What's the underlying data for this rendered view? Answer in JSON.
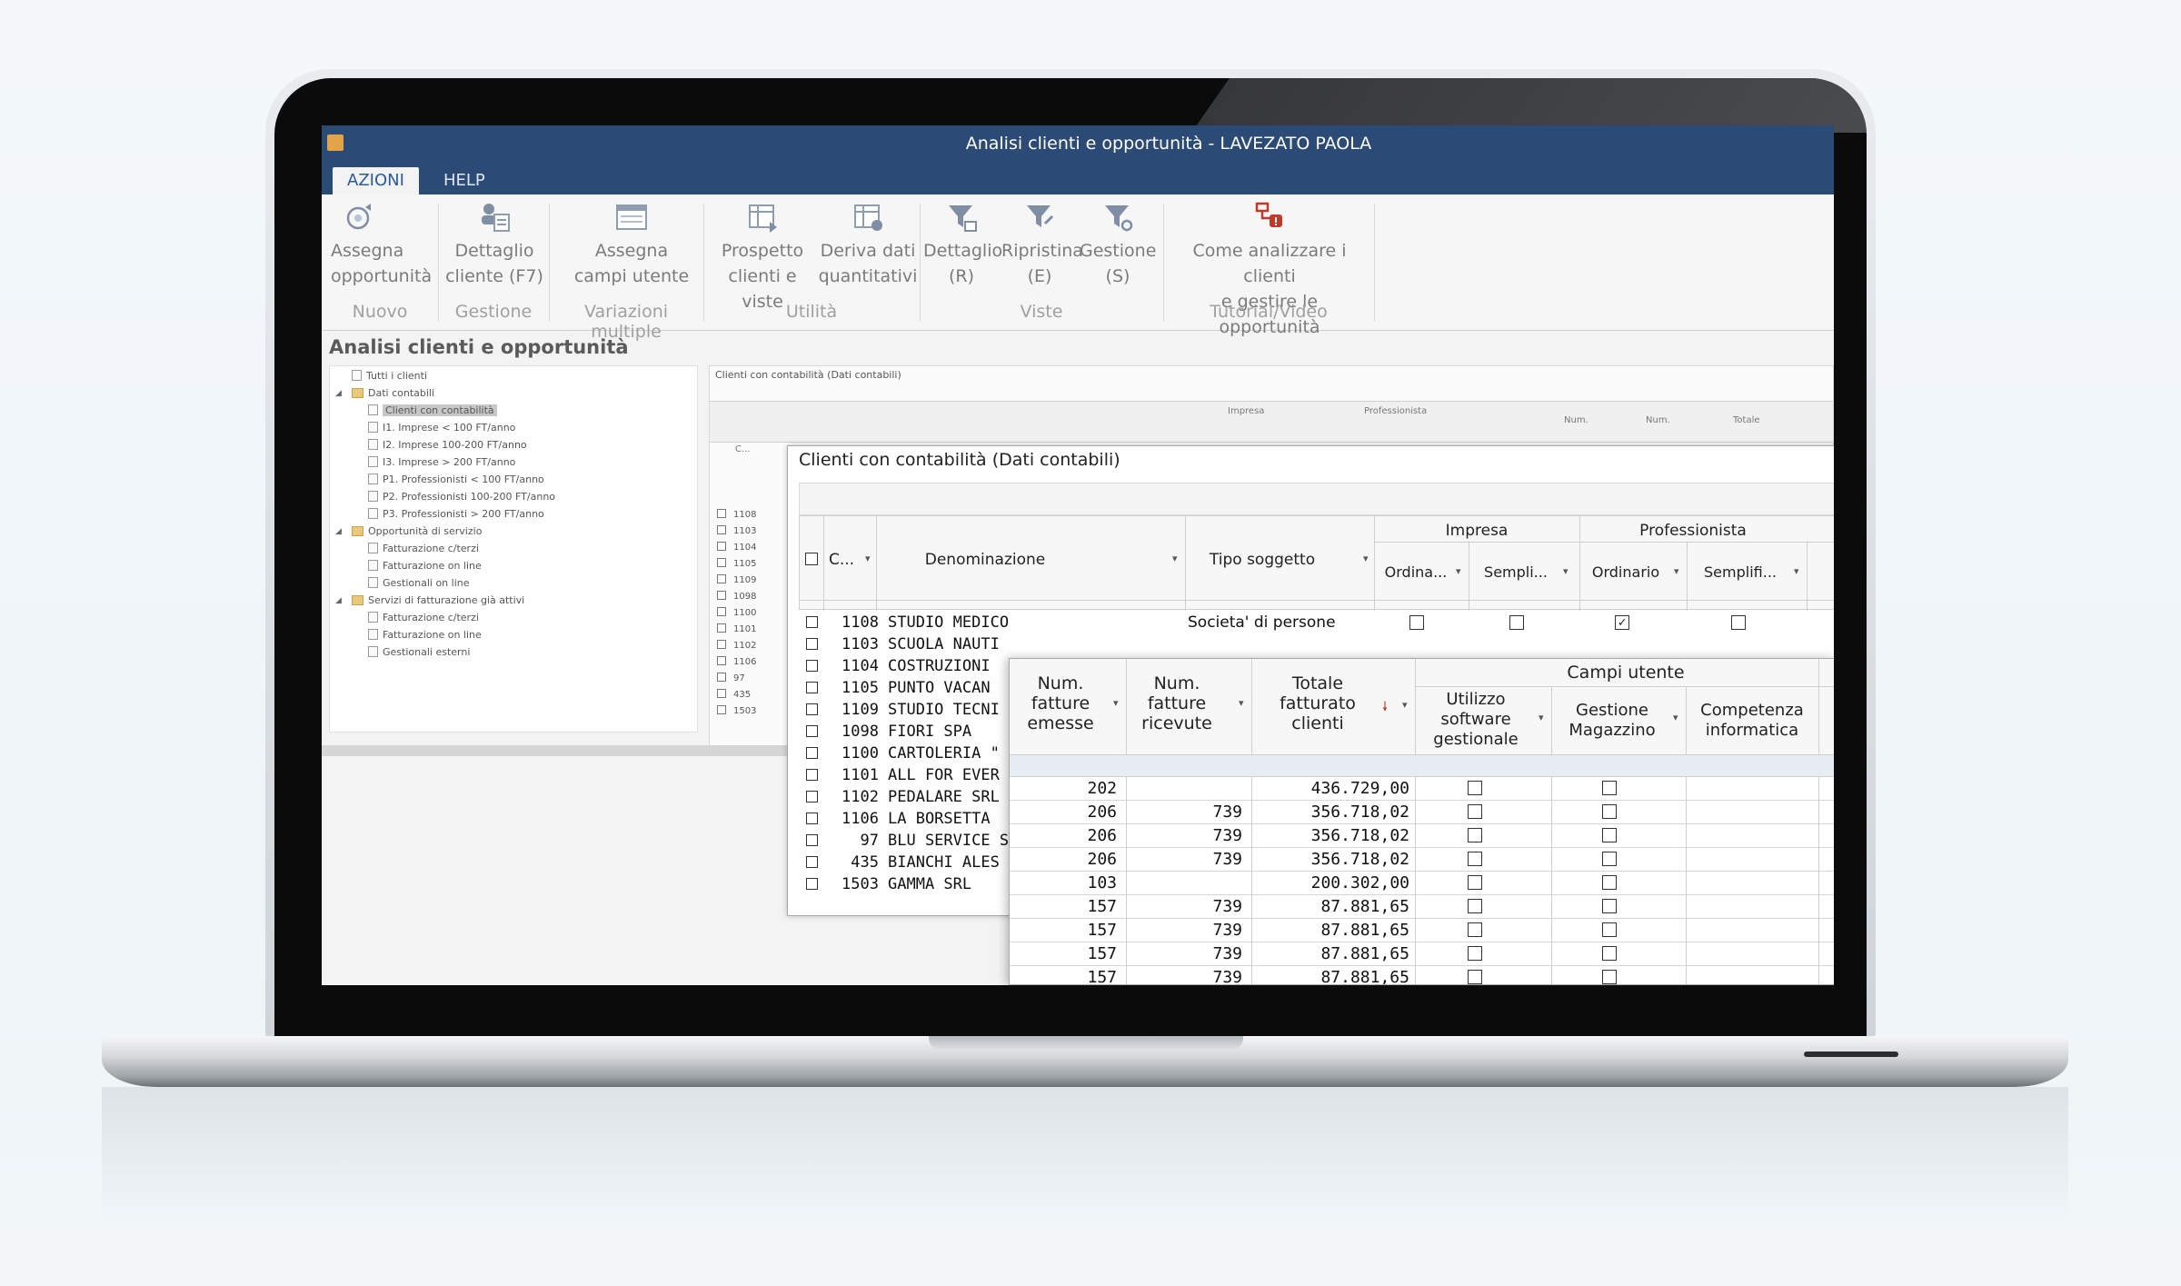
{
  "window": {
    "title": "Analisi clienti e opportunità - LAVEZATO PAOLA"
  },
  "menu_tabs": [
    "AZIONI",
    "HELP"
  ],
  "ribbon": {
    "buttons": [
      {
        "line1": "Assegna",
        "line2": "opportunità",
        "icon": "assign-opportunity-icon"
      },
      {
        "line1": "Dettaglio",
        "line2": "cliente (F7)",
        "icon": "client-detail-icon"
      },
      {
        "line1": "Assegna",
        "line2": "campi utente",
        "icon": "assign-user-fields-icon"
      },
      {
        "line1": "Prospetto",
        "line2": "clienti e viste",
        "icon": "prospect-view-icon"
      },
      {
        "line1": "Deriva dati",
        "line2": "quantitativi",
        "icon": "derive-data-icon"
      },
      {
        "line1": "Dettaglio",
        "line2": "(R)",
        "icon": "filter-detail-icon"
      },
      {
        "line1": "Ripristina",
        "line2": "(E)",
        "icon": "filter-reset-icon"
      },
      {
        "line1": "Gestione",
        "line2": "(S)",
        "icon": "filter-manage-icon"
      },
      {
        "line1": "Come analizzare i clienti",
        "line2": "e gestire le opportunità",
        "icon": "tutorial-video-icon"
      }
    ],
    "groups": [
      "Nuovo",
      "Gestione",
      "Variazioni multiple",
      "Utilità",
      "Viste",
      "Tutorial/Video"
    ]
  },
  "section_title": "Analisi clienti e opportunità",
  "tree": [
    "Tutti i clienti",
    "Dati contabili",
    "Clienti con contabilità",
    "I1. Imprese < 100 FT/anno",
    "I2. Imprese 100-200 FT/anno",
    "I3. Imprese > 200 FT/anno",
    "P1. Professionisti < 100 FT/anno",
    "P2. Professionisti 100-200 FT/anno",
    "P3. Professionisti > 200 FT/anno",
    "Opportunità di servizio",
    "Fatturazione c/terzi",
    "Fatturazione on line",
    "Gestionali on line",
    "Servizi di fatturazione già attivi",
    "Fatturazione c/terzi",
    "Fatturazione on line",
    "Gestionali esterni"
  ],
  "background_grid": {
    "caption": "Clienti con contabilità (Dati contabili)",
    "col_impresa": "Impresa",
    "col_professionista": "Professionista",
    "col_num1": "Num.",
    "col_num2": "Num.",
    "col_totale": "Totale",
    "col_c": "C...",
    "ids": [
      "1108",
      "1103",
      "1104",
      "1105",
      "1109",
      "1098",
      "1100",
      "1101",
      "1102",
      "1106",
      "97",
      "435",
      "1503"
    ]
  },
  "middle_grid": {
    "title": "Clienti con contabilità (Dati contabili)",
    "headers": {
      "c": "C...",
      "denominazione": "Denominazione",
      "tipo": "Tipo soggetto",
      "impresa": "Impresa",
      "professionista": "Professionista",
      "ordinario_abbr": "Ordina...",
      "semplificato_abbr": "Sempli...",
      "ordinario": "Ordinario",
      "semplificato_abbr2": "Semplifi..."
    },
    "rows": [
      {
        "id": "1108",
        "name": "STUDIO MEDICO",
        "tipo": "Societa' di persone",
        "checks": [
          false,
          false,
          true,
          false
        ]
      },
      {
        "id": "1103",
        "name": "SCUOLA NAUTI"
      },
      {
        "id": "1104",
        "name": "COSTRUZIONI"
      },
      {
        "id": "1105",
        "name": "PUNTO VACAN"
      },
      {
        "id": "1109",
        "name": "STUDIO TECNI"
      },
      {
        "id": "1098",
        "name": "FIORI SPA"
      },
      {
        "id": "1100",
        "name": "CARTOLERIA \""
      },
      {
        "id": "1101",
        "name": "ALL FOR EVER"
      },
      {
        "id": "1102",
        "name": "PEDALARE SRL"
      },
      {
        "id": "1106",
        "name": "LA BORSETTA"
      },
      {
        "id": "97",
        "name": "BLU SERVICE S"
      },
      {
        "id": "435",
        "name": "BIANCHI ALES"
      },
      {
        "id": "1503",
        "name": "GAMMA SRL"
      }
    ]
  },
  "front_grid": {
    "headers": {
      "num_emesse": [
        "Num.",
        "fatture",
        "emesse"
      ],
      "num_ricevute": [
        "Num.",
        "fatture",
        "ricevute"
      ],
      "totale": [
        "Totale",
        "fatturato",
        "clienti"
      ],
      "campi_utente": "Campi utente",
      "utilizzo": [
        "Utilizzo",
        "software",
        "gestionale"
      ],
      "gestione": [
        "Gestione",
        "Magazzino"
      ],
      "competenza": [
        "Competenza",
        "informatica"
      ]
    },
    "rows": [
      {
        "emesse": "202",
        "ricevute": "",
        "totale": "436.729,00"
      },
      {
        "emesse": "206",
        "ricevute": "739",
        "totale": "356.718,02"
      },
      {
        "emesse": "206",
        "ricevute": "739",
        "totale": "356.718,02"
      },
      {
        "emesse": "206",
        "ricevute": "739",
        "totale": "356.718,02"
      },
      {
        "emesse": "103",
        "ricevute": "",
        "totale": "200.302,00"
      },
      {
        "emesse": "157",
        "ricevute": "739",
        "totale": "87.881,65"
      },
      {
        "emesse": "157",
        "ricevute": "739",
        "totale": "87.881,65"
      },
      {
        "emesse": "157",
        "ricevute": "739",
        "totale": "87.881,65"
      },
      {
        "emesse": "157",
        "ricevute": "739",
        "totale": "87.881,65"
      }
    ]
  },
  "colors": {
    "titlebar": "#2b4a76",
    "tab_active_text": "#2b5b9a",
    "sort_arrow": "#c0392b",
    "folder": "#e8c87a"
  }
}
